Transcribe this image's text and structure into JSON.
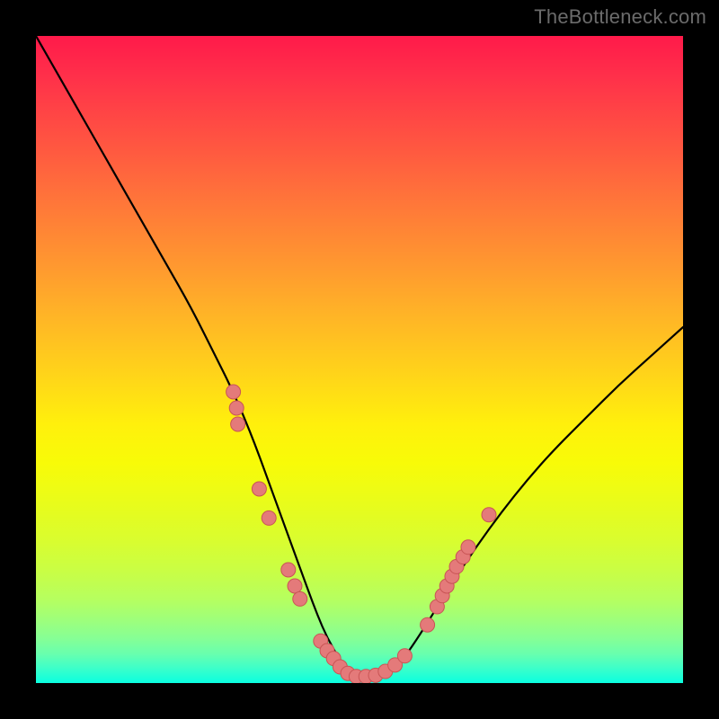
{
  "watermark": "TheBottleneck.com",
  "colors": {
    "page_bg": "#000000",
    "gradient_top": "#ff1a4a",
    "gradient_bottom": "#0affe0",
    "curve": "#000000",
    "marker_fill": "#e47a7a",
    "marker_stroke": "#c95555"
  },
  "chart_data": {
    "type": "line",
    "title": "",
    "xlabel": "",
    "ylabel": "",
    "xlim": [
      0,
      100
    ],
    "ylim": [
      0,
      100
    ],
    "grid": false,
    "legend": false,
    "series": [
      {
        "name": "curve",
        "x": [
          0,
          4,
          8,
          12,
          16,
          20,
          24,
          28,
          30,
          32,
          34,
          36,
          38,
          40,
          42,
          43.5,
          45,
          47,
          49,
          51,
          53,
          55,
          57,
          60,
          64,
          68,
          72,
          76,
          80,
          85,
          90,
          95,
          100
        ],
        "y": [
          100,
          93,
          86,
          79,
          72,
          65,
          58,
          50,
          46,
          41.5,
          36.5,
          31,
          25.5,
          20,
          14.5,
          10.5,
          7,
          3.5,
          1.3,
          0.5,
          0.7,
          1.8,
          4,
          8.5,
          15,
          21,
          26.5,
          31.5,
          36,
          41,
          46,
          50.5,
          55
        ]
      }
    ],
    "markers": [
      {
        "x": 30.5,
        "y": 45.0
      },
      {
        "x": 31.0,
        "y": 42.5
      },
      {
        "x": 31.2,
        "y": 40.0
      },
      {
        "x": 34.5,
        "y": 30.0
      },
      {
        "x": 36.0,
        "y": 25.5
      },
      {
        "x": 39.0,
        "y": 17.5
      },
      {
        "x": 40.0,
        "y": 15.0
      },
      {
        "x": 40.8,
        "y": 13.0
      },
      {
        "x": 44.0,
        "y": 6.5
      },
      {
        "x": 45.0,
        "y": 5.0
      },
      {
        "x": 46.0,
        "y": 3.8
      },
      {
        "x": 47.0,
        "y": 2.5
      },
      {
        "x": 48.2,
        "y": 1.5
      },
      {
        "x": 49.5,
        "y": 1.0
      },
      {
        "x": 51.0,
        "y": 1.0
      },
      {
        "x": 52.5,
        "y": 1.2
      },
      {
        "x": 54.0,
        "y": 1.8
      },
      {
        "x": 55.5,
        "y": 2.8
      },
      {
        "x": 57.0,
        "y": 4.2
      },
      {
        "x": 60.5,
        "y": 9.0
      },
      {
        "x": 62.0,
        "y": 11.8
      },
      {
        "x": 62.8,
        "y": 13.5
      },
      {
        "x": 63.5,
        "y": 15.0
      },
      {
        "x": 64.3,
        "y": 16.5
      },
      {
        "x": 65.0,
        "y": 18.0
      },
      {
        "x": 66.0,
        "y": 19.5
      },
      {
        "x": 66.8,
        "y": 21.0
      },
      {
        "x": 70.0,
        "y": 26.0
      }
    ],
    "marker_radius_px": 8
  }
}
